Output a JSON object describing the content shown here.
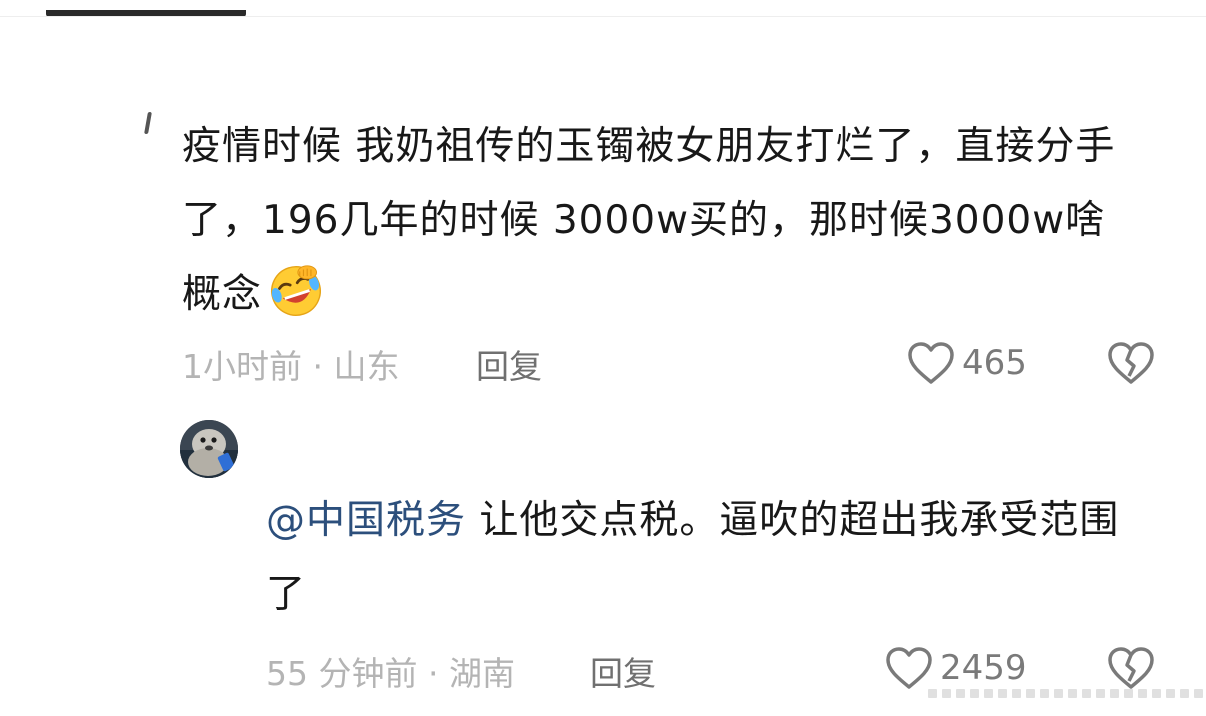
{
  "comment": {
    "text": "疫情时候 我奶祖传的玉镯被女朋友打烂了，直接分手了，196几年的时候  3000w买的，那时候3000w啥概念",
    "emoji_icon": "rolling-laughing-emoji",
    "time_location": "1小时前 · 山东",
    "reply_label": "回复",
    "like_count": "465"
  },
  "reply": {
    "mention": "@中国税务",
    "text": " 让他交点税。逼吹的超出我承受范围了",
    "time_location": "55 分钟前 · 湖南",
    "reply_label": "回复",
    "like_count": "2459"
  },
  "icons": {
    "like": "heart-icon",
    "dislike": "broken-heart-icon",
    "avatar": "seal-avatar"
  },
  "colors": {
    "text": "#181818",
    "mention": "#2c4f7c",
    "meta": "#b4b4b4",
    "icon": "#7a7a7a"
  }
}
